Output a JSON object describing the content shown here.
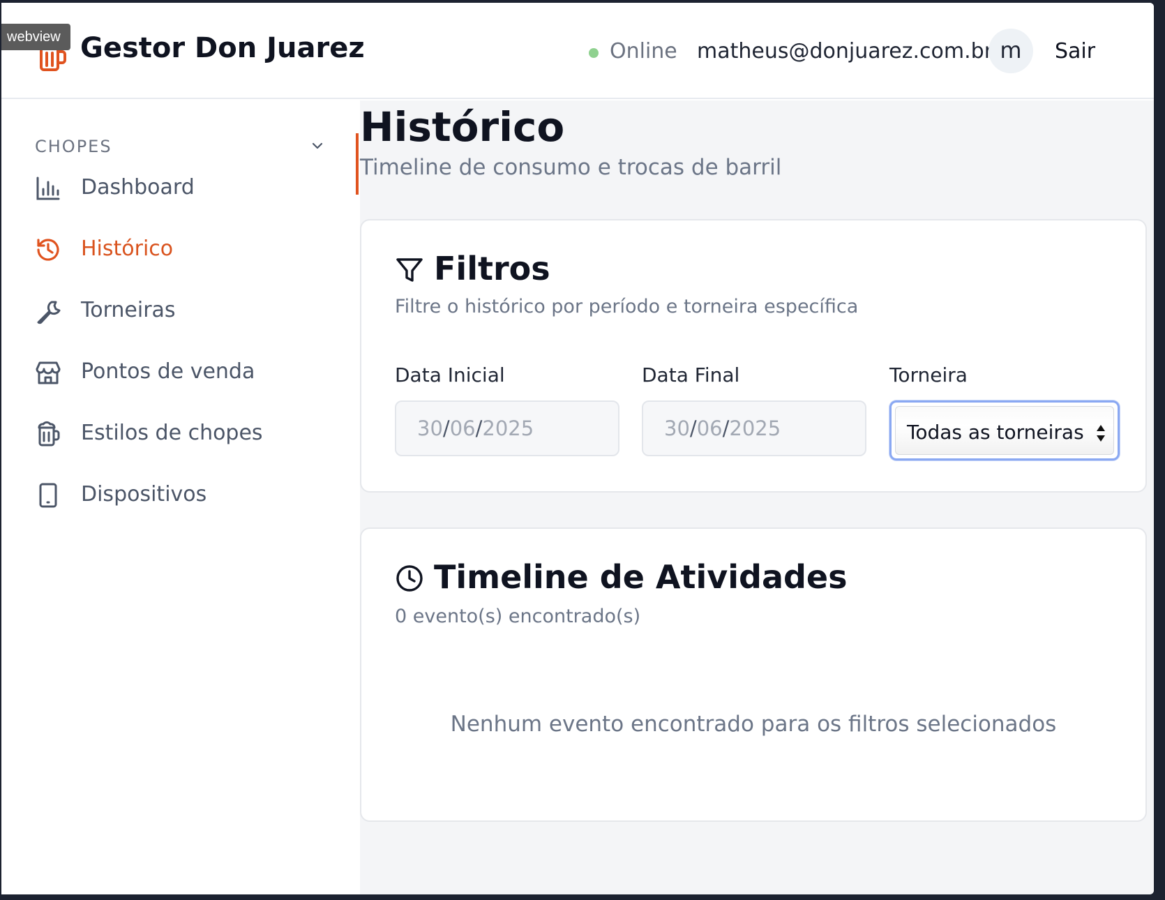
{
  "overlay": {
    "tag": "webview"
  },
  "header": {
    "brand_title": "Gestor Don Juarez",
    "status": {
      "label": "Online",
      "color": "#8fd18f"
    },
    "user_email": "matheus@donjuarez.com.br",
    "avatar_initial": "m",
    "logout_label": "Sair"
  },
  "theme": {
    "accent": "#e0531f",
    "text_muted": "#6b7587"
  },
  "sidebar": {
    "section_label": "CHOPES",
    "items": [
      {
        "label": "Dashboard",
        "icon": "bar-chart-icon",
        "active": false
      },
      {
        "label": "Histórico",
        "icon": "history-icon",
        "active": true
      },
      {
        "label": "Torneiras",
        "icon": "wrench-icon",
        "active": false
      },
      {
        "label": "Pontos de venda",
        "icon": "store-icon",
        "active": false
      },
      {
        "label": "Estilos de chopes",
        "icon": "beer-icon",
        "active": false
      },
      {
        "label": "Dispositivos",
        "icon": "tablet-icon",
        "active": false
      }
    ]
  },
  "page": {
    "title": "Histórico",
    "subtitle": "Timeline de consumo e trocas de barril"
  },
  "filters": {
    "title": "Filtros",
    "description": "Filtre o histórico por período e torneira específica",
    "start_date": {
      "label": "Data Inicial",
      "day": "30",
      "month": "06",
      "year": "2025"
    },
    "end_date": {
      "label": "Data Final",
      "day": "30",
      "month": "06",
      "year": "2025"
    },
    "tap": {
      "label": "Torneira",
      "selected": "Todas as torneiras"
    }
  },
  "timeline": {
    "title": "Timeline de Atividades",
    "count_text": "0 evento(s) encontrado(s)",
    "empty_message": "Nenhum evento encontrado para os filtros selecionados"
  }
}
